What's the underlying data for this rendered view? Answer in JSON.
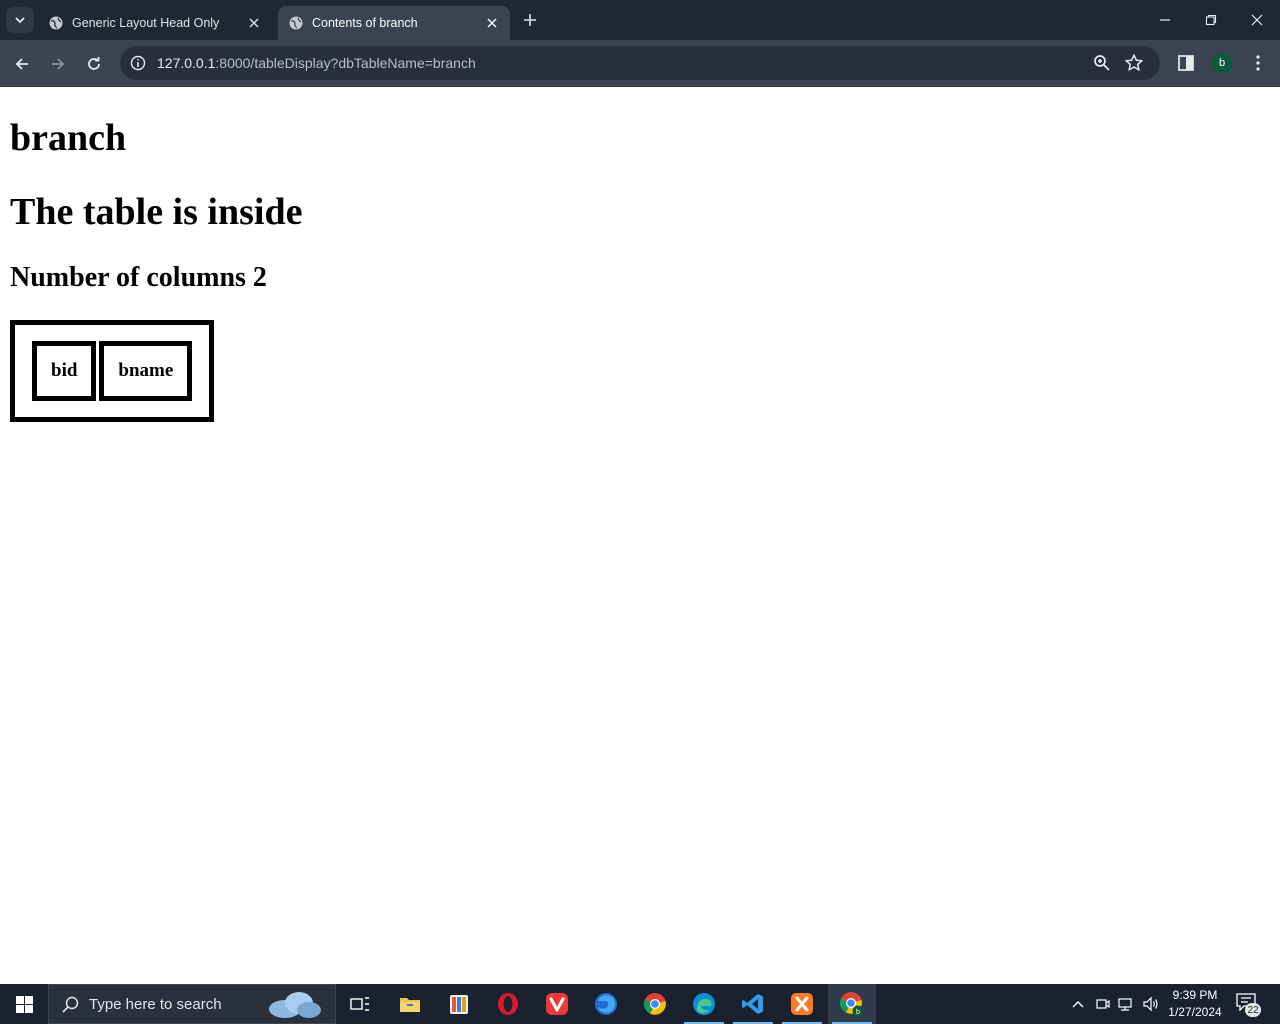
{
  "browser": {
    "tabs": [
      {
        "title": "Generic Layout Head Only",
        "active": false
      },
      {
        "title": "Contents of branch",
        "active": true
      }
    ],
    "url_host": "127.0.0.1",
    "url_rest": ":8000/tableDisplay?dbTableName=branch",
    "profile_initial": "b"
  },
  "page": {
    "heading_table_name": "branch",
    "heading_inside": "The table is inside",
    "heading_columns": "Number of columns 2",
    "table_columns": [
      "bid",
      "bname"
    ]
  },
  "taskbar": {
    "search_placeholder": "Type here to search",
    "time": "9:39 PM",
    "date": "1/27/2024",
    "notification_count": "22",
    "apps": [
      "task-view",
      "file-explorer",
      "app-generic",
      "opera",
      "vivaldi",
      "firefox",
      "chrome",
      "edge",
      "vscode",
      "xampp",
      "chrome-profile"
    ]
  },
  "colors": {
    "tabstrip_bg": "#1f2733",
    "toolbar_bg": "#3b4351",
    "taskbar_bg": "#1a2230"
  }
}
